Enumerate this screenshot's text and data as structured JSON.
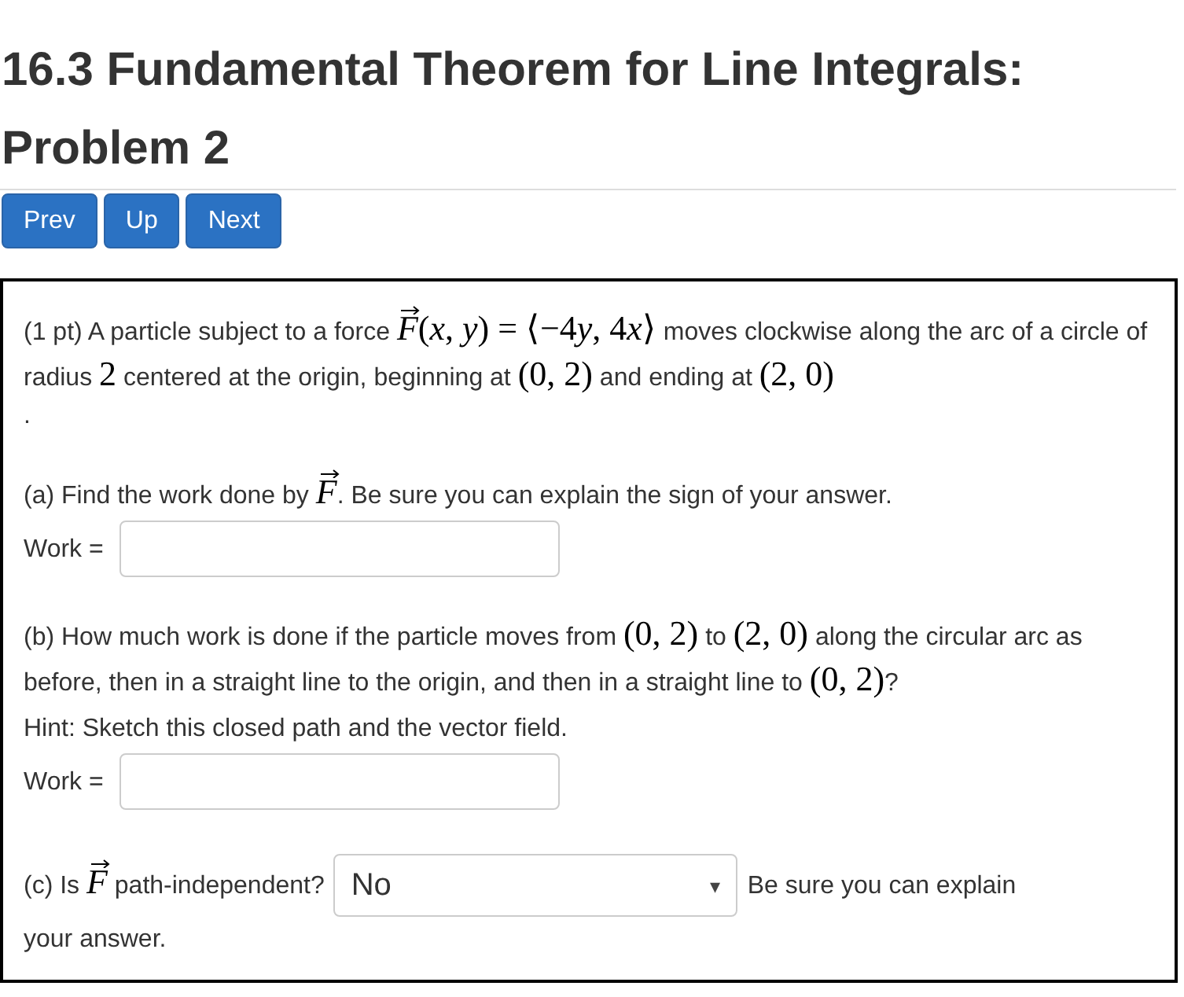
{
  "title": "16.3 Fundamental Theorem for Line Integrals: Problem 2",
  "nav_buttons": [
    "Prev",
    "Up",
    "Next"
  ],
  "problem": {
    "intro": [
      {
        "kind": "text",
        "text": "(1 pt) A particle subject to a force "
      },
      {
        "kind": "vec",
        "text": "F"
      },
      {
        "kind": "math",
        "text": "("
      },
      {
        "kind": "var",
        "text": "x"
      },
      {
        "kind": "math",
        "text": ", "
      },
      {
        "kind": "var",
        "text": "y"
      },
      {
        "kind": "math",
        "text": ") = ⟨−4"
      },
      {
        "kind": "var",
        "text": "y"
      },
      {
        "kind": "math",
        "text": ", 4"
      },
      {
        "kind": "var",
        "text": "x"
      },
      {
        "kind": "math",
        "text": "⟩"
      },
      {
        "kind": "text",
        "text": " moves clockwise along the arc of a circle of radius "
      },
      {
        "kind": "math",
        "text": "2"
      },
      {
        "kind": "text",
        "text": " centered at the origin, beginning at "
      },
      {
        "kind": "math",
        "text": "(0, 2)"
      },
      {
        "kind": "text",
        "text": " and ending at "
      },
      {
        "kind": "math",
        "text": "(2, 0)"
      }
    ],
    "intro_end": ".",
    "part_a": [
      {
        "kind": "text",
        "text": "(a) Find the work done by "
      },
      {
        "kind": "vec",
        "text": "F"
      },
      {
        "kind": "text",
        "text": ". Be sure you can explain the sign of your answer."
      }
    ],
    "work_a": {
      "label": "Work ="
    },
    "part_b": [
      {
        "kind": "text",
        "text": "(b) How much work is done if the particle moves from "
      },
      {
        "kind": "math",
        "text": "(0, 2)"
      },
      {
        "kind": "text",
        "text": " to "
      },
      {
        "kind": "math",
        "text": "(2, 0)"
      },
      {
        "kind": "text",
        "text": " along the circular arc as before, then in a straight line to the origin, and then in a straight line to "
      },
      {
        "kind": "math",
        "text": "(0, 2)"
      },
      {
        "kind": "text",
        "text": "?"
      }
    ],
    "hint": "Hint: Sketch this closed path and the vector field.",
    "work_b": {
      "label": "Work ="
    },
    "part_c": [
      {
        "kind": "text",
        "text": "(c) Is "
      },
      {
        "kind": "vec",
        "text": "F"
      },
      {
        "kind": "text",
        "text": " path-independent?"
      }
    ],
    "select": {
      "value": "No",
      "caret": "▾"
    },
    "part_c_after": "Be sure you can explain",
    "part_c_end": "your answer."
  }
}
